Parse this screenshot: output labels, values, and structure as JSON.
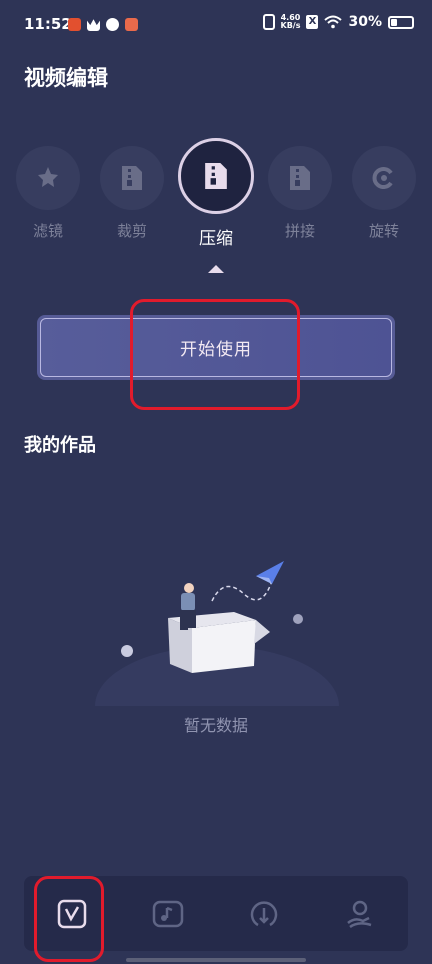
{
  "status_bar": {
    "time": "11:52",
    "net_speed_value": "4.60",
    "net_speed_unit": "KB/s",
    "x_badge": "X",
    "battery": "30%"
  },
  "page": {
    "title": "视频编辑"
  },
  "tools": [
    {
      "label": "滤镜",
      "icon": "magic-wand-icon",
      "active": false
    },
    {
      "label": "裁剪",
      "icon": "zip-file-icon",
      "active": false
    },
    {
      "label": "压缩",
      "icon": "zip-file-icon",
      "active": true
    },
    {
      "label": "拼接",
      "icon": "zip-file-icon",
      "active": false
    },
    {
      "label": "旋转",
      "icon": "rotate-icon",
      "active": false
    }
  ],
  "start_button": {
    "label": "开始使用"
  },
  "works": {
    "title": "我的作品",
    "empty_text": "暂无数据"
  },
  "bottom_nav": [
    {
      "icon": "video-edit-icon",
      "active": true
    },
    {
      "icon": "music-video-icon",
      "active": false
    },
    {
      "icon": "download-icon",
      "active": false
    },
    {
      "icon": "profile-icon",
      "active": false
    }
  ],
  "colors": {
    "background": "#2e3456",
    "accent": "#565b96",
    "annotation_red": "#e11b2c"
  }
}
